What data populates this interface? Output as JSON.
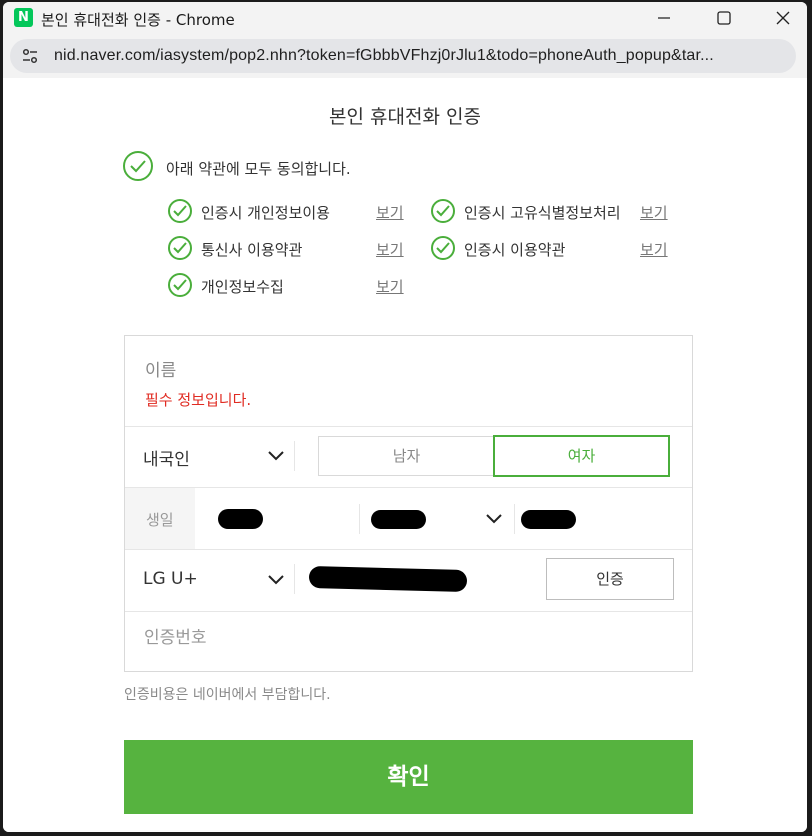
{
  "window": {
    "app_icon_letter": "N",
    "title": "본인 휴대전화 인증 - Chrome"
  },
  "address_bar": {
    "url": "nid.naver.com/iasystem/pop2.nhn?token=fGbbbVFhzj0rJlu1&todo=phoneAuth_popup&tar..."
  },
  "page": {
    "title": "본인 휴대전화 인증",
    "agree_all_label": "아래 약관에 모두 동의합니다.",
    "terms": [
      {
        "label": "인증시 개인정보이용",
        "view": "보기"
      },
      {
        "label": "인증시 고유식별정보처리",
        "view": "보기"
      },
      {
        "label": "통신사 이용약관",
        "view": "보기"
      },
      {
        "label": "인증시 이용약관",
        "view": "보기"
      },
      {
        "label": "개인정보수집",
        "view": "보기"
      }
    ]
  },
  "form": {
    "name_label": "이름",
    "name_error": "필수 정보입니다.",
    "nationality": "내국인",
    "gender_male": "남자",
    "gender_female": "여자",
    "gender_selected": "여자",
    "birth_label": "생일",
    "carrier": "LG U+",
    "auth_button": "인증",
    "code_placeholder": "인증번호",
    "cost_note": "인증비용은 네이버에서 부담합니다.",
    "confirm_button": "확인"
  },
  "colors": {
    "accent_green": "#56b33f",
    "check_green": "#4aae3b",
    "error_red": "#e02b22",
    "naver_green": "#03c75a"
  },
  "icons": {
    "check": "check-circle-icon",
    "chevron": "chevron-down-icon",
    "site_info": "tune-icon"
  }
}
